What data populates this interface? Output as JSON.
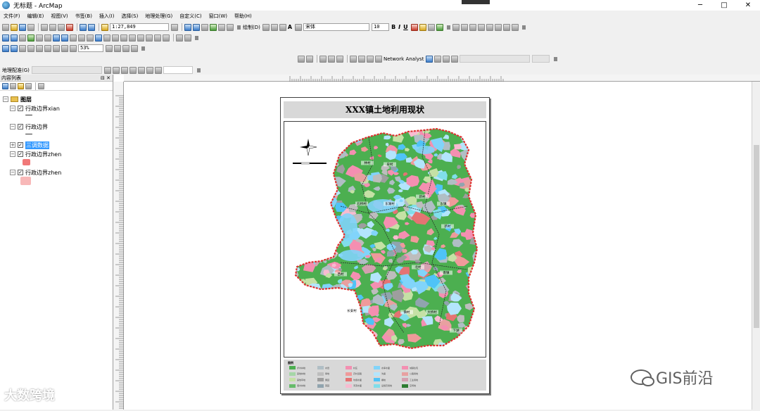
{
  "window": {
    "title": "无标题 - ArcMap",
    "min": "─",
    "max": "□",
    "close": "✕"
  },
  "menu": [
    "文件(F)",
    "编辑(E)",
    "视图(V)",
    "书签(B)",
    "插入(I)",
    "选择(S)",
    "地理处理(G)",
    "自定义(C)",
    "窗口(W)",
    "帮助(H)"
  ],
  "toolbar": {
    "scale_value": "1:27,849",
    "draw_label": "绘制(D)",
    "font_name": "宋体",
    "font_size": "10",
    "bold": "B",
    "italic": "I",
    "underline": "U",
    "text_tool": "A",
    "zoom_value": "53%",
    "network_analyst": "Network Analyst",
    "georef_label": "地理配准(G)"
  },
  "toc": {
    "title": "内容列表",
    "pin": "⊟ ✕",
    "root": "图层",
    "layers": [
      {
        "name": "行政边界xian",
        "checked": "✓"
      },
      {
        "name": "行政边界",
        "checked": "✓"
      },
      {
        "name": "三调数据",
        "checked": "✓"
      },
      {
        "name": "行政边界zhen",
        "checked": "✓"
      },
      {
        "name": "行政边界zhen",
        "checked": "✓"
      }
    ],
    "expand_minus": "−",
    "expand_plus": "+"
  },
  "layout": {
    "map_title": "XXX镇土地利用现状",
    "legend_title": "图例",
    "legend_items": [
      {
        "label": "乔木林地",
        "color": "#4caf50"
      },
      {
        "label": "其他林地",
        "color": "#a5d6a7"
      },
      {
        "label": "其他草地",
        "color": "#c5e1a5"
      },
      {
        "label": "灌木林地",
        "color": "#66bb6a"
      },
      {
        "label": "水田",
        "color": "#b0bec5"
      },
      {
        "label": "旱地",
        "color": "#bdbdbd"
      },
      {
        "label": "果园",
        "color": "#9e9e9e"
      },
      {
        "label": "茶园",
        "color": "#90a4ae"
      },
      {
        "label": "村庄",
        "color": "#f48fb1"
      },
      {
        "label": "农村道路",
        "color": "#ef9a9a"
      },
      {
        "label": "坑塘水面",
        "color": "#e57373"
      },
      {
        "label": "河流水面",
        "color": "#f8bbd0"
      },
      {
        "label": "水库水面",
        "color": "#81d4fa"
      },
      {
        "label": "沟渠",
        "color": "#b3e5fc"
      },
      {
        "label": "裸地",
        "color": "#4fc3f7"
      },
      {
        "label": "设施农用地",
        "color": "#80deea"
      },
      {
        "label": "城镇住宅",
        "color": "#f48fb1"
      },
      {
        "label": "公路用地",
        "color": "#e8a0a0"
      },
      {
        "label": "工业用地",
        "color": "#d4a0b0"
      },
      {
        "label": "空闲地",
        "color": "#2e7d32"
      }
    ],
    "place_labels": [
      "林村",
      "泉村",
      "新村",
      "东镇",
      "新村",
      "石桥村",
      "东湖村",
      "南镇",
      "北村",
      "长安村",
      "镇村",
      "大桥村",
      "下湖",
      "西村"
    ]
  },
  "watermarks": {
    "left": "大数跨境",
    "right": "GIS前沿"
  }
}
